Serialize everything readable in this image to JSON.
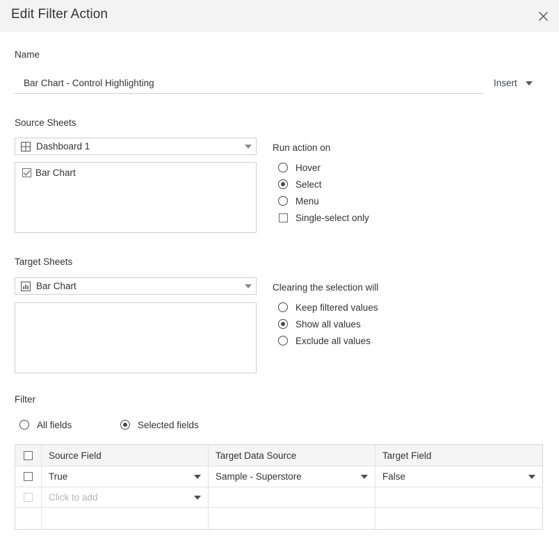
{
  "dialog": {
    "title": "Edit Filter Action",
    "close_icon": "close-icon"
  },
  "name_section": {
    "label": "Name",
    "value": "Bar Chart - Control Highlighting",
    "placeholder": "",
    "insert_label": "Insert",
    "insert_caret_icon": "chevron-down-icon"
  },
  "source_sheets": {
    "label": "Source Sheets",
    "dropdown": {
      "value": "Dashboard 1",
      "icon": "dashboard-grid-icon",
      "caret_icon": "chevron-down-icon"
    },
    "sheets": [
      {
        "label": "Bar Chart",
        "checked": true
      }
    ]
  },
  "run_action_on": {
    "label": "Run action on",
    "options": [
      {
        "label": "Hover",
        "selected": false
      },
      {
        "label": "Select",
        "selected": true
      },
      {
        "label": "Menu",
        "selected": false
      }
    ],
    "single_select": {
      "label": "Single-select only",
      "checked": false
    }
  },
  "target_sheets": {
    "label": "Target Sheets",
    "dropdown": {
      "value": "Bar Chart",
      "icon": "worksheet-bar-icon",
      "caret_icon": "chevron-down-icon"
    },
    "sheets": []
  },
  "clearing_selection": {
    "label": "Clearing the selection will",
    "options": [
      {
        "label": "Keep filtered values",
        "selected": false
      },
      {
        "label": "Show all values",
        "selected": true
      },
      {
        "label": "Exclude all values",
        "selected": false
      }
    ]
  },
  "filter": {
    "label": "Filter",
    "options": [
      {
        "label": "All fields",
        "selected": false
      },
      {
        "label": "Selected fields",
        "selected": true
      }
    ],
    "table": {
      "headers": [
        "Source Field",
        "Target Data Source",
        "Target Field"
      ],
      "header_checkbox_checked": false,
      "rows": [
        {
          "checked": false,
          "checkbox_enabled": true,
          "source_field": "True",
          "target_data_source": "Sample - Superstore",
          "target_field": "False",
          "muted": false
        },
        {
          "checked": false,
          "checkbox_enabled": false,
          "source_field": "Click to add",
          "target_data_source": "",
          "target_field": "",
          "muted": true
        },
        {
          "checked": null,
          "checkbox_enabled": false,
          "source_field": "",
          "target_data_source": "",
          "target_field": "",
          "muted": false
        }
      ]
    }
  },
  "colors": {
    "titlebar_bg": "#f3f3f3",
    "text": "#333333",
    "border": "#cfcfcf",
    "table_header_bg": "#f5f5f5",
    "muted_text": "#b5b5b5",
    "insert_text": "#3b4552"
  }
}
